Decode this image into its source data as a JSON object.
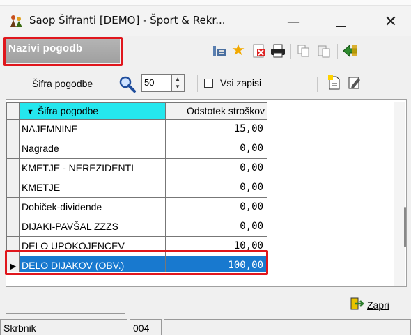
{
  "window": {
    "title": "Saop Šifranti [DEMO] - Šport & Rekr...",
    "icons": {
      "minimize": "minimize-icon",
      "maximize": "maximize-icon",
      "close": "close-icon",
      "app": "app-icon"
    }
  },
  "module": {
    "title": "Nazivi pogodb"
  },
  "toolbar": {
    "icons": [
      "filter-icon",
      "star-icon",
      "delete-icon",
      "print-icon",
      "copy-icon",
      "paste-icon",
      "exit-icon"
    ]
  },
  "search": {
    "label": "Šifra pogodbe",
    "count": "50",
    "all_records_label": "Vsi zapisi",
    "all_records_checked": false
  },
  "table": {
    "columns": [
      "Šifra pogodbe",
      "Odstotek stroškov"
    ],
    "rows": [
      {
        "code": "NAJEMNINE",
        "pct": "15,00"
      },
      {
        "code": "Nagrade",
        "pct": "0,00"
      },
      {
        "code": "KMETJE - NEREZIDENTI",
        "pct": "0,00"
      },
      {
        "code": "KMETJE",
        "pct": "0,00"
      },
      {
        "code": "Dobiček-dividende",
        "pct": "0,00"
      },
      {
        "code": "DIJAKI-PAVŠAL ZZZS",
        "pct": "0,00"
      },
      {
        "code": "DELO UPOKOJENCEV",
        "pct": "10,00"
      },
      {
        "code": "DELO DIJAKOV (OBV.)",
        "pct": "100,00"
      }
    ],
    "selected_row": 7
  },
  "footer": {
    "close_label": "Zapri"
  },
  "status": {
    "user_label": "Skrbnik",
    "code": "004"
  },
  "colors": {
    "highlight": "#e0161c",
    "header_sorted": "#25e7ee",
    "selection": "#1879cf"
  }
}
